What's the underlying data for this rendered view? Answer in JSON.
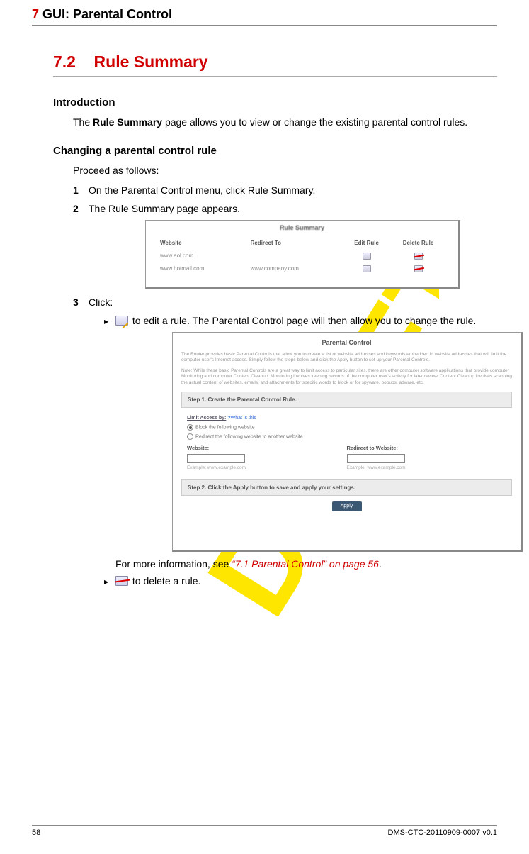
{
  "chapter": {
    "num": "7",
    "title": "GUI: Parental Control"
  },
  "section": {
    "num": "7.2",
    "title": "Rule Summary"
  },
  "intro": {
    "heading": "Introduction",
    "text_pre": "The ",
    "text_bold": "Rule Summary",
    "text_post": " page allows you to view or change the existing parental control rules."
  },
  "changing": {
    "heading": "Changing a parental control rule",
    "lead": "Proceed as follows:",
    "steps": {
      "s1": {
        "num": "1",
        "pre": "On the ",
        "b1": "Parental Control",
        "mid": " menu, click ",
        "b2": "Rule Summary",
        "post": "."
      },
      "s2": {
        "num": "2",
        "pre": "The ",
        "b1": "Rule Summary",
        "post": " page appears."
      },
      "s3": {
        "num": "3",
        "text": "Click:"
      }
    },
    "rule_summary_shot": {
      "title": "Rule Summary",
      "headers": {
        "c1": "Website",
        "c2": "Redirect To",
        "c3": "Edit Rule",
        "c4": "Delete Rule"
      },
      "rows": [
        {
          "c1": "www.aol.com",
          "c2": ""
        },
        {
          "c1": "www.hotmail.com",
          "c2": "www.company.com"
        }
      ]
    },
    "click_items": {
      "edit": {
        "pre": " to edit a rule. The ",
        "bold": "Parental Control",
        "post": " page will then allow you to change the rule."
      },
      "delete": {
        "text": " to delete a rule."
      }
    },
    "parental_shot": {
      "title": "Parental Control",
      "desc1": "The Router provides basic Parental Controls that allow you to create a list of website addresses and keywords embedded in website addresses that will limit the computer user's Internet access. Simply follow the steps below and click the Apply button to set up your Parental Controls.",
      "desc2": "Note: While these basic Parental Controls are a great way to limit access to particular sites, there are other computer software applications that provide computer Monitoring and computer Content Cleanup. Monitoring involves keeping records of the computer user's activity for later review. Content Cleanup involves scanning the actual content of websites, emails, and attachments for specific words to block or for spyware, popups, adware, etc.",
      "step1": "Step 1. Create the Parental Control Rule.",
      "limit_label": "Limit Access by:",
      "limit_hint": "What is this",
      "radio1": "Block the following website",
      "radio2": "Redirect the following website to another website",
      "field1": "Website:",
      "ex1": "Example: www.example.com",
      "field2": "Redirect to Website:",
      "ex2": "Example: www.example.com",
      "step2": "Step 2. Click the Apply button to save and apply your settings.",
      "apply": "Apply"
    },
    "more_info": {
      "pre": "For more information, see ",
      "xref": "“7.1 Parental Control” on page 56",
      "post": "."
    }
  },
  "footer": {
    "page": "58",
    "docid": "DMS-CTC-20110909-0007 v0.1"
  }
}
